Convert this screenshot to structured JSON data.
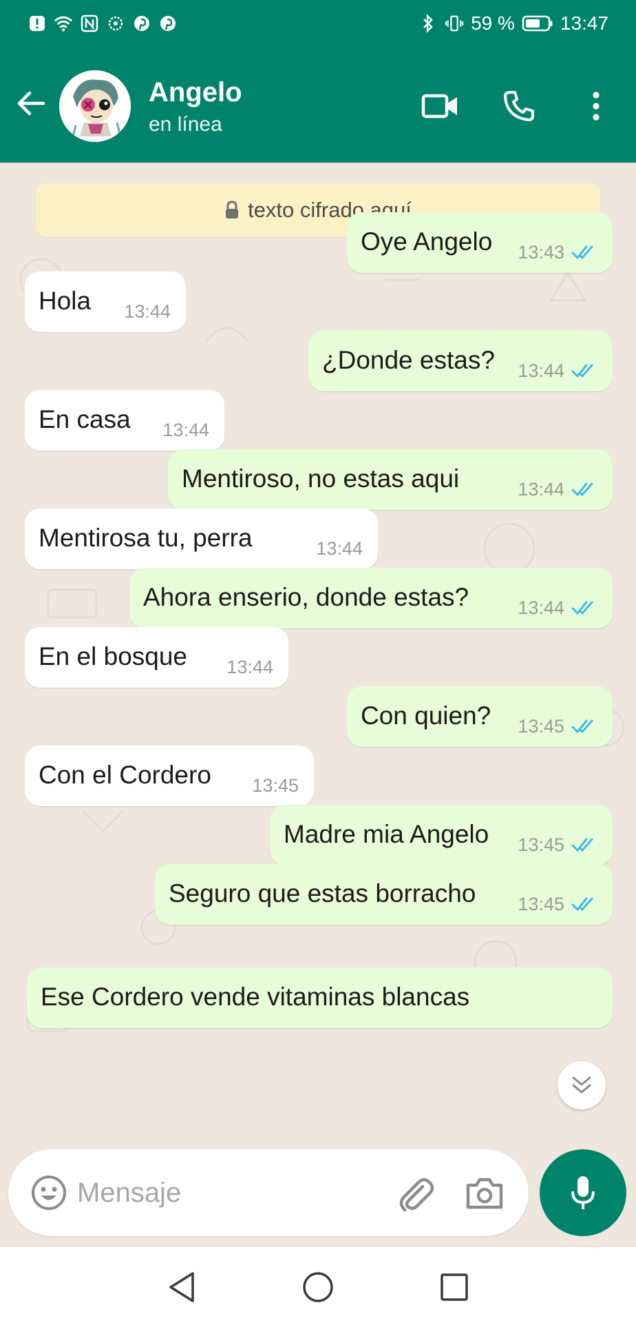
{
  "status_bar": {
    "battery": "59 %",
    "time": "13:47"
  },
  "header": {
    "contact_name": "Angelo",
    "contact_status": "en línea"
  },
  "encryption_notice": "texto cifrado aquí",
  "messages": [
    {
      "dir": "out",
      "text": "Oye Angelo",
      "time": "13:43"
    },
    {
      "dir": "in",
      "text": "Hola",
      "time": "13:44"
    },
    {
      "dir": "out",
      "text": "¿Donde estas?",
      "time": "13:44"
    },
    {
      "dir": "in",
      "text": "En casa",
      "time": "13:44"
    },
    {
      "dir": "out",
      "text": "Mentiroso, no estas aqui",
      "time": "13:44"
    },
    {
      "dir": "in",
      "text": "Mentirosa tu, perra",
      "time": "13:44"
    },
    {
      "dir": "out",
      "text": "Ahora enserio, donde estas?",
      "time": "13:44"
    },
    {
      "dir": "in",
      "text": "En el bosque",
      "time": "13:44"
    },
    {
      "dir": "out",
      "text": "Con quien?",
      "time": "13:45"
    },
    {
      "dir": "in",
      "text": "Con el Cordero",
      "time": "13:45"
    },
    {
      "dir": "out",
      "text": "Madre mia Angelo",
      "time": "13:45"
    },
    {
      "dir": "out",
      "text": "Seguro que estas borracho",
      "time": "13:45"
    },
    {
      "dir": "out",
      "text": "Ese Cordero vende vitaminas blancas",
      "time": ""
    }
  ],
  "composer": {
    "placeholder": "Mensaje"
  },
  "colors": {
    "brand": "#00836b",
    "outgoing_bubble": "#e6fdd7",
    "incoming_bubble": "#ffffff",
    "read_ticks": "#34b7f1",
    "notice_bg": "#fbf1c4"
  },
  "icons": {
    "status_left": [
      "alert-icon",
      "wifi-icon",
      "nfc-icon",
      "sync-icon",
      "pinterest-icon",
      "pinterest-icon"
    ],
    "status_right": [
      "bluetooth-icon",
      "vibrate-icon",
      "battery-icon"
    ],
    "header": [
      "back-arrow-icon",
      "video-call-icon",
      "phone-icon",
      "more-vertical-icon"
    ],
    "composer": [
      "emoji-icon",
      "attach-icon",
      "camera-icon",
      "mic-icon"
    ],
    "nav": [
      "nav-back-icon",
      "nav-home-icon",
      "nav-recents-icon"
    ]
  }
}
